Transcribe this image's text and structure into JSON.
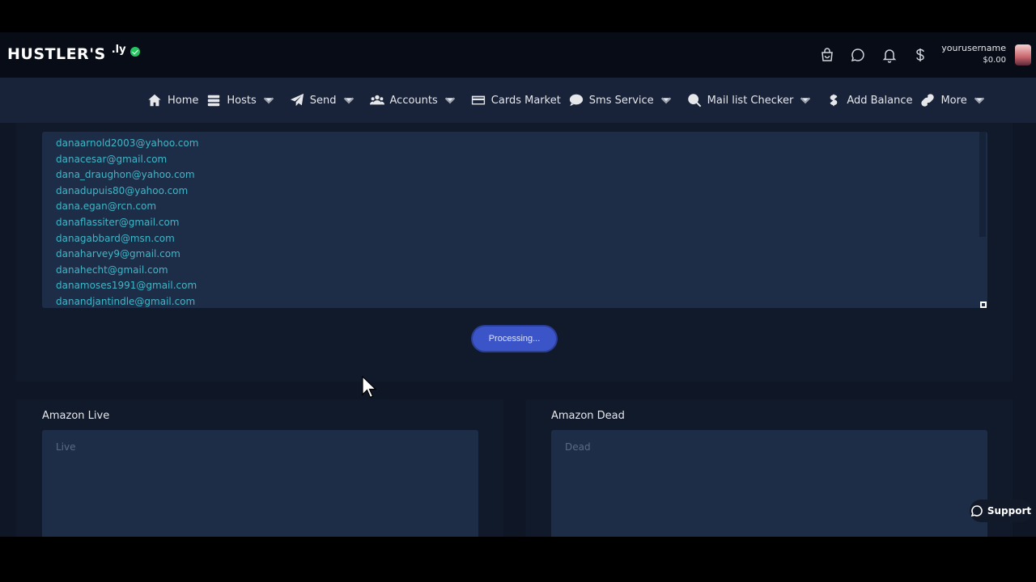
{
  "brand": {
    "name": "HUSTLER'S",
    "suffix": ".ly"
  },
  "user": {
    "username": "yourusername",
    "balance": "$0.00"
  },
  "nav": {
    "items": [
      {
        "label": "Home",
        "icon": "home-icon",
        "dropdown": false
      },
      {
        "label": "Hosts",
        "icon": "server-icon",
        "dropdown": true
      },
      {
        "label": "Send",
        "icon": "paper-plane-icon",
        "dropdown": true
      },
      {
        "label": "Accounts",
        "icon": "users-icon",
        "dropdown": true
      },
      {
        "label": "Cards Market",
        "icon": "credit-card-icon",
        "dropdown": false
      },
      {
        "label": "Sms Service",
        "icon": "sms-icon",
        "dropdown": true
      },
      {
        "label": "Mail list Checker",
        "icon": "search-icon",
        "dropdown": true
      },
      {
        "label": "Add Balance",
        "icon": "dollar-icon",
        "dropdown": false
      },
      {
        "label": "More",
        "icon": "link-icon",
        "dropdown": true
      }
    ]
  },
  "emails": [
    "danaarnold2003@yahoo.com",
    "danacesar@gmail.com",
    "dana_draughon@yahoo.com",
    "danadupuis80@yahoo.com",
    "dana.egan@rcn.com",
    "danaflassiter@gmail.com",
    "danagabbard@msn.com",
    "danaharvey9@gmail.com",
    "danahecht@gmail.com",
    "danamoses1991@gmail.com",
    "danandjantindle@gmail.com"
  ],
  "process_button": "Processing...",
  "results": {
    "live": {
      "title": "Amazon Live",
      "placeholder": "Live"
    },
    "dead": {
      "title": "Amazon Dead",
      "placeholder": "Dead"
    }
  },
  "support_label": "Support"
}
